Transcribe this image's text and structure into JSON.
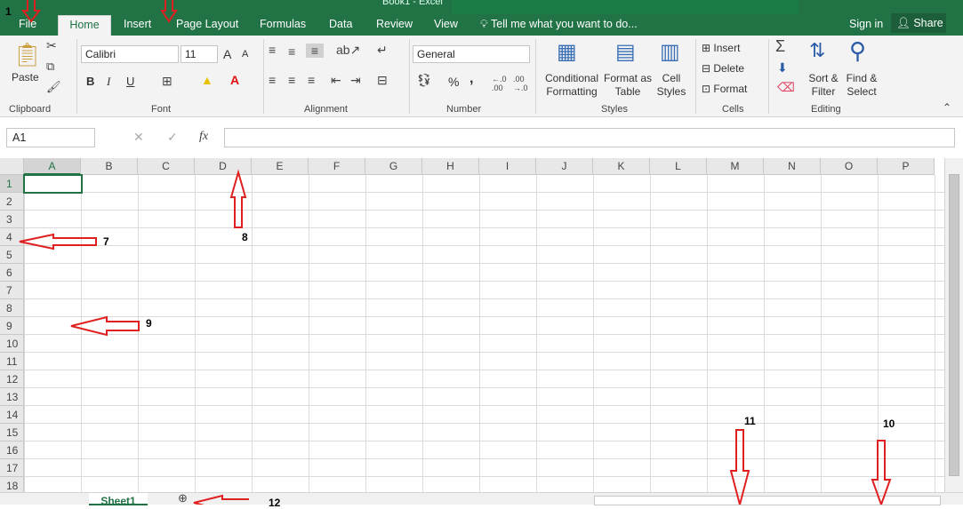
{
  "window": {
    "title": "Book1 - Excel"
  },
  "ribbon_tabs": [
    "File",
    "Home",
    "Insert",
    "Page Layout",
    "Formulas",
    "Data",
    "Review",
    "View"
  ],
  "tell_me": "Tell me what you want to do...",
  "account": {
    "signin": "Sign in",
    "share": "Share"
  },
  "clipboard": {
    "paste": "Paste",
    "group": "Clipboard"
  },
  "font": {
    "name": "Calibri",
    "size": "11",
    "grow": "A",
    "shrink": "A",
    "bold": "B",
    "italic": "I",
    "underline": "U",
    "group": "Font"
  },
  "alignment": {
    "group": "Alignment"
  },
  "number": {
    "format": "General",
    "percent": "%",
    "comma": ",",
    "group": "Number"
  },
  "styles": {
    "conditional": [
      "Conditional",
      "Formatting"
    ],
    "format_table": [
      "Format as",
      "Table"
    ],
    "cell_styles": [
      "Cell",
      "Styles"
    ],
    "group": "Styles"
  },
  "cells_group": {
    "insert": "Insert",
    "delete": "Delete",
    "format": "Format",
    "group": "Cells"
  },
  "editing": {
    "sort": [
      "Sort &",
      "Filter"
    ],
    "find": [
      "Find &",
      "Select"
    ],
    "group": "Editing"
  },
  "formula_bar": {
    "namebox": "A1",
    "fx": "fx",
    "cancel": "✕",
    "enter": "✓"
  },
  "columns": [
    "A",
    "B",
    "C",
    "D",
    "E",
    "F",
    "G",
    "H",
    "I",
    "J",
    "K",
    "L",
    "M",
    "N",
    "O",
    "P"
  ],
  "rows": [
    "1",
    "2",
    "3",
    "4",
    "5",
    "6",
    "7",
    "8",
    "9",
    "10",
    "11",
    "12",
    "13",
    "14",
    "15",
    "16",
    "17",
    "18"
  ],
  "sheet": {
    "tab": "Sheet1"
  },
  "annotations": [
    "1",
    "7",
    "8",
    "9",
    "10",
    "11",
    "12"
  ],
  "colors": {
    "accent": "#217346",
    "arrow": "#e02020"
  }
}
